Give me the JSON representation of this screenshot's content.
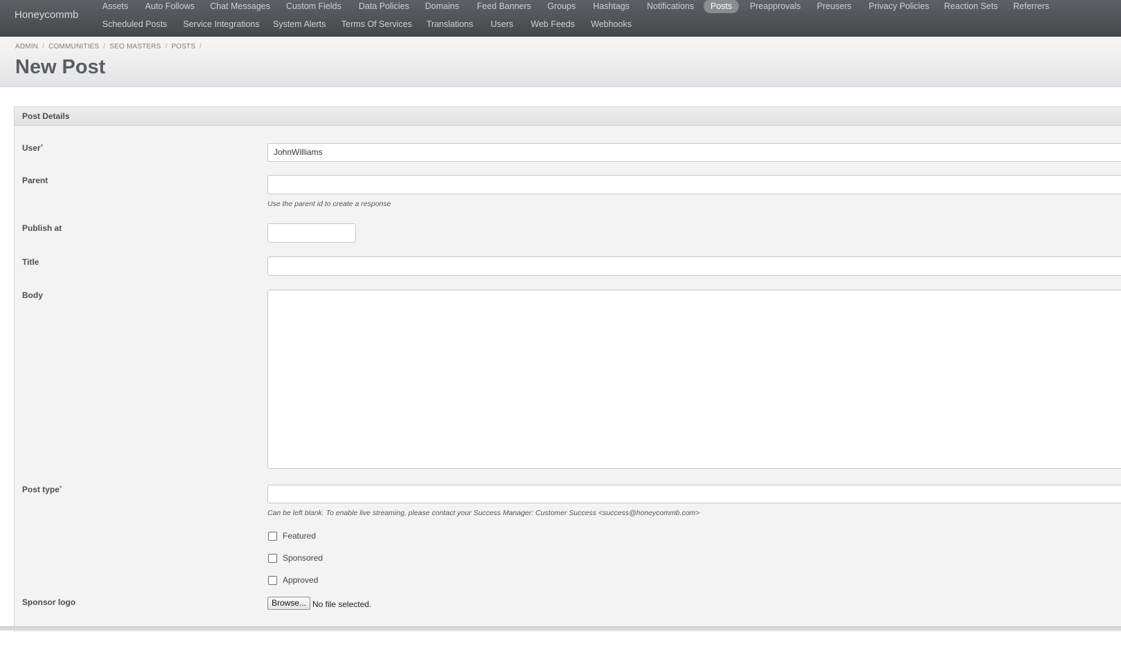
{
  "brand": "Honeycommb",
  "nav": {
    "row1": [
      "Assets",
      "Auto Follows",
      "Chat Messages",
      "Custom Fields",
      "Data Policies",
      "Domains",
      "Feed Banners",
      "Groups",
      "Hashtags",
      "Notifications",
      "Posts",
      "Preapprovals",
      "Preusers",
      "Privacy Policies",
      "Reaction Sets",
      "Referrers"
    ],
    "row2": [
      "Scheduled Posts",
      "Service Integrations",
      "System Alerts",
      "Terms Of Services",
      "Translations",
      "Users",
      "Web Feeds",
      "Webhooks"
    ],
    "active": "Posts"
  },
  "breadcrumb": [
    "ADMIN",
    "COMMUNITIES",
    "SEO MASTERS",
    "POSTS"
  ],
  "page_title": "New Post",
  "panel_title": "Post Details",
  "form": {
    "user": {
      "label": "User",
      "required_mark": "*",
      "value": "JohnWilliams"
    },
    "parent": {
      "label": "Parent",
      "value": "",
      "hint": "Use the parent id to create a response"
    },
    "publish_at": {
      "label": "Publish at",
      "value": ""
    },
    "title": {
      "label": "Title",
      "value": ""
    },
    "body": {
      "label": "Body",
      "value": ""
    },
    "post_type": {
      "label": "Post type",
      "required_mark": "*",
      "value": "",
      "hint": "Can be left blank. To enable live streaming, please contact your Success Manager: Customer Success <success@honeycommb.com>"
    },
    "checkboxes": [
      {
        "label": "Featured",
        "checked": false
      },
      {
        "label": "Sponsored",
        "checked": false
      },
      {
        "label": "Approved",
        "checked": false
      }
    ],
    "sponsor_logo": {
      "label": "Sponsor logo",
      "button": "Browse...",
      "status": "No file selected."
    }
  }
}
